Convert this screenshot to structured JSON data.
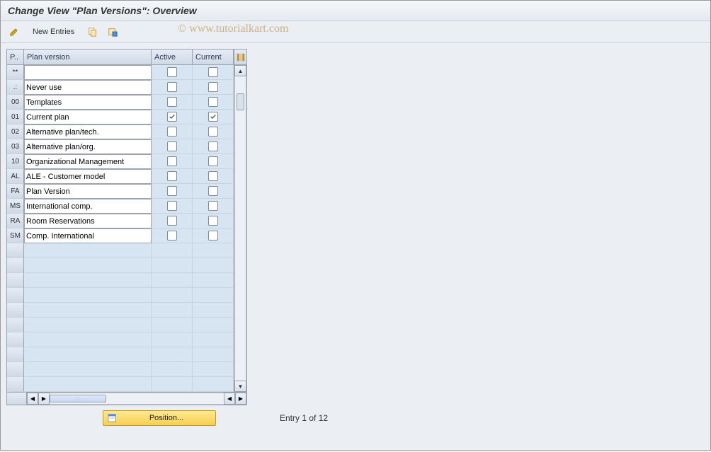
{
  "title": "Change View \"Plan Versions\": Overview",
  "toolbar": {
    "new_entries_label": "New Entries"
  },
  "watermark": "© www.tutorialkart.com",
  "columns": {
    "index": "P..",
    "plan_version": "Plan version",
    "active": "Active",
    "current": "Current"
  },
  "col_widths": {
    "index": 24,
    "plan_version": 180,
    "active": 58,
    "current": 58
  },
  "rows": [
    {
      "code": "**",
      "name": "",
      "active": false,
      "current": false
    },
    {
      "code": ".:",
      "name": "Never use",
      "active": false,
      "current": false
    },
    {
      "code": "00",
      "name": "Templates",
      "active": false,
      "current": false
    },
    {
      "code": "01",
      "name": "Current plan",
      "active": true,
      "current": true
    },
    {
      "code": "02",
      "name": "Alternative plan/tech.",
      "active": false,
      "current": false
    },
    {
      "code": "03",
      "name": "Alternative plan/org.",
      "active": false,
      "current": false
    },
    {
      "code": "10",
      "name": "Organizational Management",
      "active": false,
      "current": false
    },
    {
      "code": "AL",
      "name": "ALE - Customer model",
      "active": false,
      "current": false
    },
    {
      "code": "FA",
      "name": "Plan Version",
      "active": false,
      "current": false
    },
    {
      "code": "MS",
      "name": "International comp.",
      "active": false,
      "current": false
    },
    {
      "code": "RA",
      "name": "Room Reservations",
      "active": false,
      "current": false
    },
    {
      "code": "SM",
      "name": "Comp. International",
      "active": false,
      "current": false
    }
  ],
  "empty_rows": 10,
  "footer": {
    "position_label": "Position...",
    "entry_text": "Entry 1 of 12"
  }
}
